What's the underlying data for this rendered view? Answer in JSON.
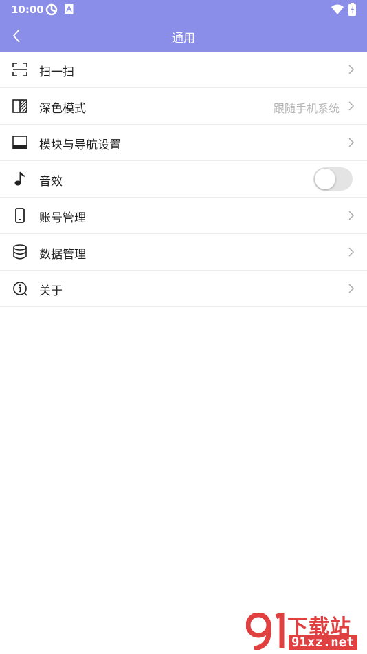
{
  "status_bar": {
    "time": "10:00"
  },
  "app_bar": {
    "title": "通用"
  },
  "menu": {
    "items": [
      {
        "label": "扫一扫"
      },
      {
        "label": "深色模式",
        "value": "跟随手机系统"
      },
      {
        "label": "模块与导航设置"
      },
      {
        "label": "音效",
        "toggle_on": false
      },
      {
        "label": "账号管理"
      },
      {
        "label": "数据管理"
      },
      {
        "label": "关于"
      }
    ]
  },
  "watermark": {
    "line1": "下载站",
    "line2": "91xz.net"
  },
  "colors": {
    "accent": "#8a8ee8",
    "watermark": "#e04040"
  }
}
